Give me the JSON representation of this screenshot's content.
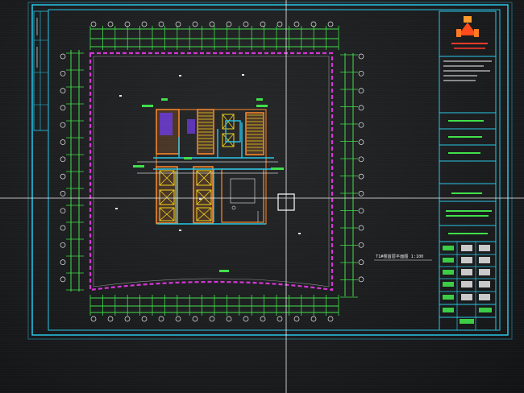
{
  "drawing": {
    "plan_title": "T1#楼首层平面图 1:100",
    "company_logo": "logo-icon",
    "title_block": {
      "approval_rows": [
        {
          "role": "审定",
          "sign": "张三"
        },
        {
          "role": "审核",
          "sign": "李四"
        },
        {
          "role": "设计",
          "sign": "王五"
        },
        {
          "role": "制图",
          "sign": "赵六"
        },
        {
          "role": "校对",
          "sign": "周七"
        }
      ]
    },
    "grid_left": [
      "A",
      "B",
      "C",
      "D",
      "E",
      "F",
      "G",
      "H",
      "J",
      "K",
      "L",
      "M",
      "N",
      "P"
    ],
    "grid_bottom": [
      "1",
      "2",
      "3",
      "4",
      "5",
      "6",
      "7",
      "8",
      "9",
      "10",
      "11",
      "12",
      "13",
      "14",
      "15"
    ]
  },
  "colors": {
    "frame": "#27c7e8",
    "dim": "#3fe04a",
    "boundary": "#d535d5",
    "wall": "#ff8a2a",
    "white": "#e8e8e8",
    "yellow": "#f4d21c"
  }
}
